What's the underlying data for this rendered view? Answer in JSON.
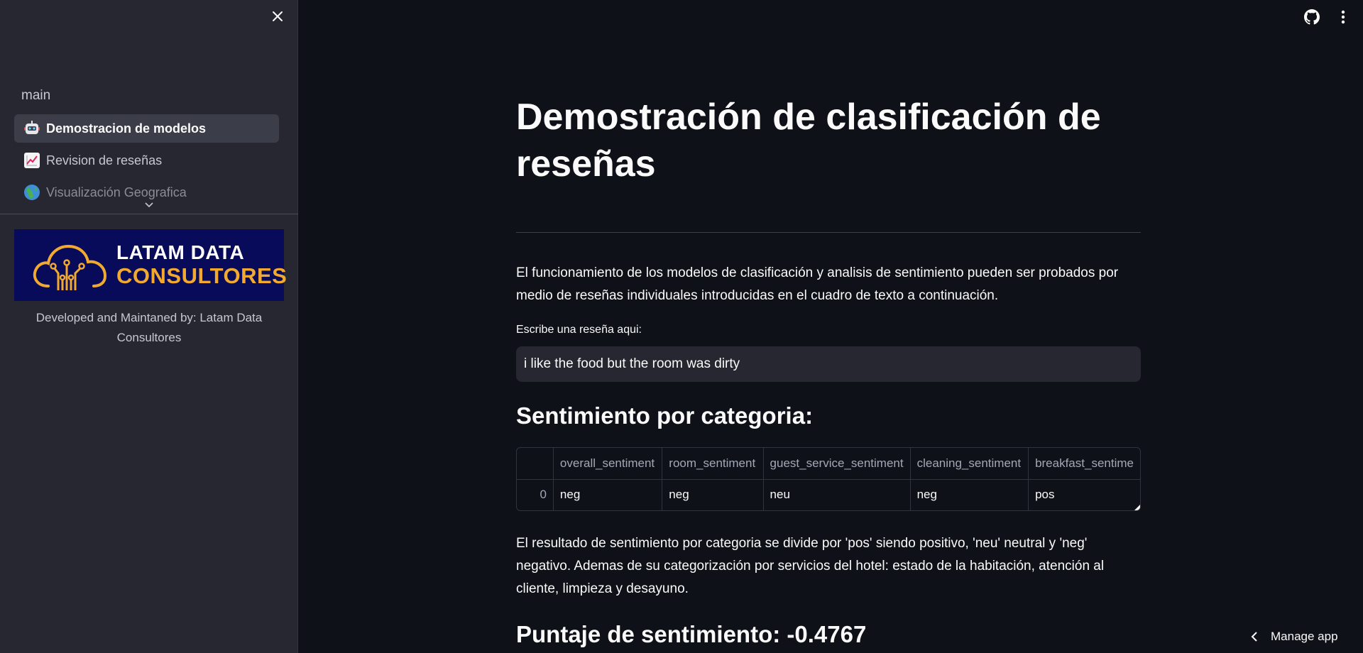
{
  "sidebar": {
    "nav_title": "main",
    "items": [
      {
        "label": "Demostracion de modelos",
        "icon": "robot-icon",
        "active": true
      },
      {
        "label": "Revision de reseñas",
        "icon": "chart-increasing-icon",
        "active": false
      },
      {
        "label": "Visualización Geografica",
        "icon": "globe-icon",
        "active": false
      }
    ],
    "logo": {
      "line1": "LATAM DATA",
      "line2": "CONSULTORES",
      "bg_color": "#080a5a",
      "accent_color": "#f1a92f"
    },
    "caption": "Developed and Maintaned by: Latam Data Consultores"
  },
  "header": {
    "icons": [
      "github-icon",
      "more-vertical-icon"
    ]
  },
  "main": {
    "title": "Demostración de clasificación de reseñas",
    "intro": "El funcionamiento de los modelos de clasificación y analisis de sentimiento pueden ser probados por medio de reseñas individuales introducidas en el cuadro de texto a continuación.",
    "input_label": "Escribe una reseña aqui:",
    "input_value": "i like the food but the room was dirty",
    "subheader": "Sentimiento por categoria:",
    "table": {
      "columns": [
        "",
        "overall_sentiment",
        "room_sentiment",
        "guest_service_sentiment",
        "cleaning_sentiment",
        "breakfast_sentime"
      ],
      "rows": [
        [
          "0",
          "neg",
          "neg",
          "neu",
          "neg",
          "pos"
        ]
      ]
    },
    "explanation": "El resultado de sentimiento por categoria se divide por 'pos' siendo positivo, 'neu' neutral y 'neg' negativo. Ademas de su categorización por servicios del hotel: estado de la habitación, atención al cliente, limpieza y desayuno.",
    "score_heading": "Puntaje de sentimiento: -0.4767"
  },
  "footer": {
    "manage_label": "Manage app"
  }
}
